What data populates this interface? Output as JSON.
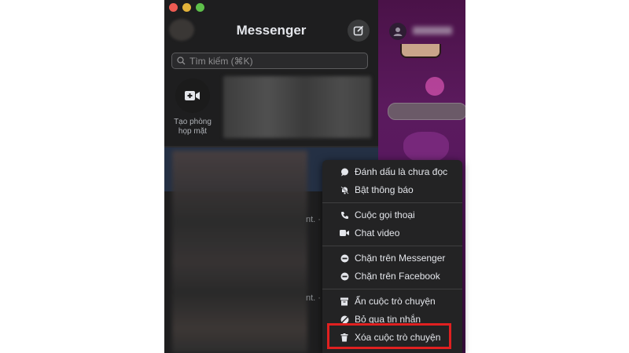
{
  "app": {
    "title": "Messenger"
  },
  "search": {
    "placeholder": "Tìm kiếm (⌘K)"
  },
  "room": {
    "label_line1": "Tạo phòng",
    "label_line2": "họp mặt"
  },
  "chat_list": {
    "preview_fragments": [
      "nt. ·",
      "nt. ·"
    ]
  },
  "context_menu": {
    "groups": [
      [
        {
          "label": "Đánh dấu là chưa đọc",
          "icon": "chat-bubble-icon"
        },
        {
          "label": "Bật thông báo",
          "icon": "bell-muted-icon"
        }
      ],
      [
        {
          "label": "Cuộc gọi thoại",
          "icon": "phone-icon"
        },
        {
          "label": "Chat video",
          "icon": "video-camera-icon"
        }
      ],
      [
        {
          "label": "Chặn trên Messenger",
          "icon": "block-icon"
        },
        {
          "label": "Chặn trên Facebook",
          "icon": "block-icon"
        }
      ],
      [
        {
          "label": "Ẩn cuộc trò chuyện",
          "icon": "archive-icon"
        },
        {
          "label": "Bỏ qua tin nhắn",
          "icon": "ignore-icon"
        },
        {
          "label": "Xóa cuộc trò chuyện",
          "icon": "trash-icon"
        }
      ]
    ]
  },
  "colors": {
    "highlight_border": "#e02020",
    "accent_conversation": "#571860"
  }
}
